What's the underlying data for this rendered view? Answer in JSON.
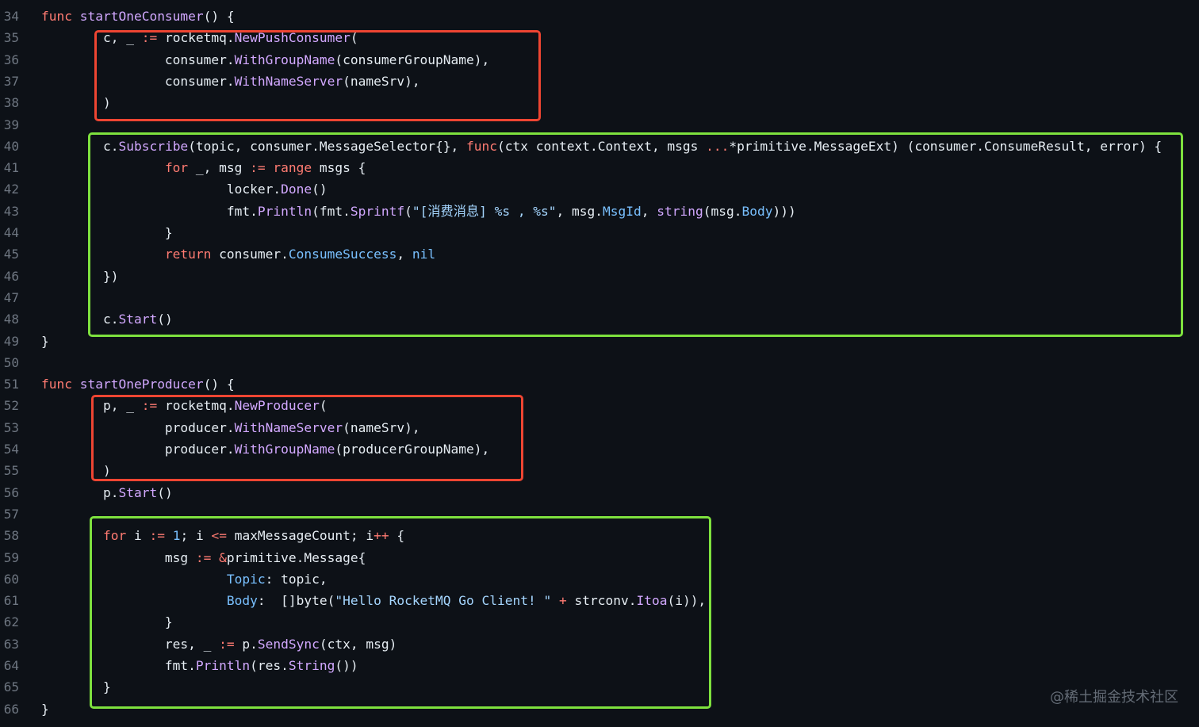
{
  "colors": {
    "background": "#0d1117",
    "keyword": "#ff7b72",
    "function": "#d2a8ff",
    "string": "#a5d6ff",
    "constant": "#79c0ff",
    "plain": "#e6edf3",
    "line_number": "#6e7681",
    "red_highlight": "#ee4532",
    "green_highlight": "#7ee13e"
  },
  "watermark": "@稀土掘金技术社区",
  "code_lines": [
    {
      "n": "34",
      "tokens": [
        [
          "kw",
          "func"
        ],
        [
          "pl",
          " "
        ],
        [
          "fn",
          "startOneConsumer"
        ],
        [
          "pl",
          "() {"
        ]
      ]
    },
    {
      "n": "35",
      "tokens": [
        [
          "pl",
          "        c, _ "
        ],
        [
          "kw",
          ":="
        ],
        [
          "pl",
          " rocketmq."
        ],
        [
          "fn",
          "NewPushConsumer"
        ],
        [
          "pl",
          "("
        ]
      ]
    },
    {
      "n": "36",
      "tokens": [
        [
          "pl",
          "                consumer."
        ],
        [
          "fn",
          "WithGroupName"
        ],
        [
          "pl",
          "(consumerGroupName),"
        ]
      ]
    },
    {
      "n": "37",
      "tokens": [
        [
          "pl",
          "                consumer."
        ],
        [
          "fn",
          "WithNameServer"
        ],
        [
          "pl",
          "(nameSrv),"
        ]
      ]
    },
    {
      "n": "38",
      "tokens": [
        [
          "pl",
          "        )"
        ]
      ]
    },
    {
      "n": "39",
      "tokens": []
    },
    {
      "n": "40",
      "tokens": [
        [
          "pl",
          "        c."
        ],
        [
          "fn",
          "Subscribe"
        ],
        [
          "pl",
          "(topic, consumer.MessageSelector{}, "
        ],
        [
          "kw",
          "func"
        ],
        [
          "pl",
          "(ctx context.Context, msgs "
        ],
        [
          "kw",
          "..."
        ],
        [
          "pl",
          "*primitive.MessageExt) (consumer.ConsumeResult, error) {"
        ]
      ]
    },
    {
      "n": "41",
      "tokens": [
        [
          "pl",
          "                "
        ],
        [
          "kw",
          "for"
        ],
        [
          "pl",
          " _, msg "
        ],
        [
          "kw",
          ":="
        ],
        [
          "pl",
          " "
        ],
        [
          "kw",
          "range"
        ],
        [
          "pl",
          " msgs {"
        ]
      ]
    },
    {
      "n": "42",
      "tokens": [
        [
          "pl",
          "                        locker."
        ],
        [
          "fn",
          "Done"
        ],
        [
          "pl",
          "()"
        ]
      ]
    },
    {
      "n": "43",
      "tokens": [
        [
          "pl",
          "                        fmt."
        ],
        [
          "fn",
          "Println"
        ],
        [
          "pl",
          "(fmt."
        ],
        [
          "fn",
          "Sprintf"
        ],
        [
          "pl",
          "("
        ],
        [
          "str",
          "\"[消费消息] %s , %s\""
        ],
        [
          "pl",
          ", msg."
        ],
        [
          "con",
          "MsgId"
        ],
        [
          "pl",
          ", "
        ],
        [
          "fn",
          "string"
        ],
        [
          "pl",
          "(msg."
        ],
        [
          "con",
          "Body"
        ],
        [
          "pl",
          ")))"
        ]
      ]
    },
    {
      "n": "44",
      "tokens": [
        [
          "pl",
          "                }"
        ]
      ]
    },
    {
      "n": "45",
      "tokens": [
        [
          "pl",
          "                "
        ],
        [
          "kw",
          "return"
        ],
        [
          "pl",
          " consumer."
        ],
        [
          "con",
          "ConsumeSuccess"
        ],
        [
          "pl",
          ", "
        ],
        [
          "con",
          "nil"
        ]
      ]
    },
    {
      "n": "46",
      "tokens": [
        [
          "pl",
          "        })"
        ]
      ]
    },
    {
      "n": "47",
      "tokens": []
    },
    {
      "n": "48",
      "tokens": [
        [
          "pl",
          "        c."
        ],
        [
          "fn",
          "Start"
        ],
        [
          "pl",
          "()"
        ]
      ]
    },
    {
      "n": "49",
      "tokens": [
        [
          "pl",
          "}"
        ]
      ]
    },
    {
      "n": "50",
      "tokens": []
    },
    {
      "n": "51",
      "tokens": [
        [
          "kw",
          "func"
        ],
        [
          "pl",
          " "
        ],
        [
          "fn",
          "startOneProducer"
        ],
        [
          "pl",
          "() {"
        ]
      ]
    },
    {
      "n": "52",
      "tokens": [
        [
          "pl",
          "        p, _ "
        ],
        [
          "kw",
          ":="
        ],
        [
          "pl",
          " rocketmq."
        ],
        [
          "fn",
          "NewProducer"
        ],
        [
          "pl",
          "("
        ]
      ]
    },
    {
      "n": "53",
      "tokens": [
        [
          "pl",
          "                producer."
        ],
        [
          "fn",
          "WithNameServer"
        ],
        [
          "pl",
          "(nameSrv),"
        ]
      ]
    },
    {
      "n": "54",
      "tokens": [
        [
          "pl",
          "                producer."
        ],
        [
          "fn",
          "WithGroupName"
        ],
        [
          "pl",
          "(producerGroupName),"
        ]
      ]
    },
    {
      "n": "55",
      "tokens": [
        [
          "pl",
          "        )"
        ]
      ]
    },
    {
      "n": "56",
      "tokens": [
        [
          "pl",
          "        p."
        ],
        [
          "fn",
          "Start"
        ],
        [
          "pl",
          "()"
        ]
      ]
    },
    {
      "n": "57",
      "tokens": []
    },
    {
      "n": "58",
      "tokens": [
        [
          "pl",
          "        "
        ],
        [
          "kw",
          "for"
        ],
        [
          "pl",
          " i "
        ],
        [
          "kw",
          ":="
        ],
        [
          "pl",
          " "
        ],
        [
          "con",
          "1"
        ],
        [
          "pl",
          "; i "
        ],
        [
          "kw",
          "<="
        ],
        [
          "pl",
          " maxMessageCount; i"
        ],
        [
          "kw",
          "++"
        ],
        [
          "pl",
          " {"
        ]
      ]
    },
    {
      "n": "59",
      "tokens": [
        [
          "pl",
          "                msg "
        ],
        [
          "kw",
          ":="
        ],
        [
          "pl",
          " "
        ],
        [
          "kw",
          "&"
        ],
        [
          "pl",
          "primitive.Message{"
        ]
      ]
    },
    {
      "n": "60",
      "tokens": [
        [
          "pl",
          "                        "
        ],
        [
          "con",
          "Topic"
        ],
        [
          "pl",
          ": topic,"
        ]
      ]
    },
    {
      "n": "61",
      "tokens": [
        [
          "pl",
          "                        "
        ],
        [
          "con",
          "Body"
        ],
        [
          "pl",
          ":  []byte("
        ],
        [
          "str",
          "\"Hello RocketMQ Go Client! \""
        ],
        [
          "pl",
          " "
        ],
        [
          "kw",
          "+"
        ],
        [
          "pl",
          " strconv."
        ],
        [
          "fn",
          "Itoa"
        ],
        [
          "pl",
          "(i)),"
        ]
      ]
    },
    {
      "n": "62",
      "tokens": [
        [
          "pl",
          "                }"
        ]
      ]
    },
    {
      "n": "63",
      "tokens": [
        [
          "pl",
          "                res, _ "
        ],
        [
          "kw",
          ":="
        ],
        [
          "pl",
          " p."
        ],
        [
          "fn",
          "SendSync"
        ],
        [
          "pl",
          "(ctx, msg)"
        ]
      ]
    },
    {
      "n": "64",
      "tokens": [
        [
          "pl",
          "                fmt."
        ],
        [
          "fn",
          "Println"
        ],
        [
          "pl",
          "(res."
        ],
        [
          "fn",
          "String"
        ],
        [
          "pl",
          "())"
        ]
      ]
    },
    {
      "n": "65",
      "tokens": [
        [
          "pl",
          "        }"
        ]
      ]
    },
    {
      "n": "66",
      "tokens": [
        [
          "pl",
          "}"
        ]
      ]
    }
  ]
}
